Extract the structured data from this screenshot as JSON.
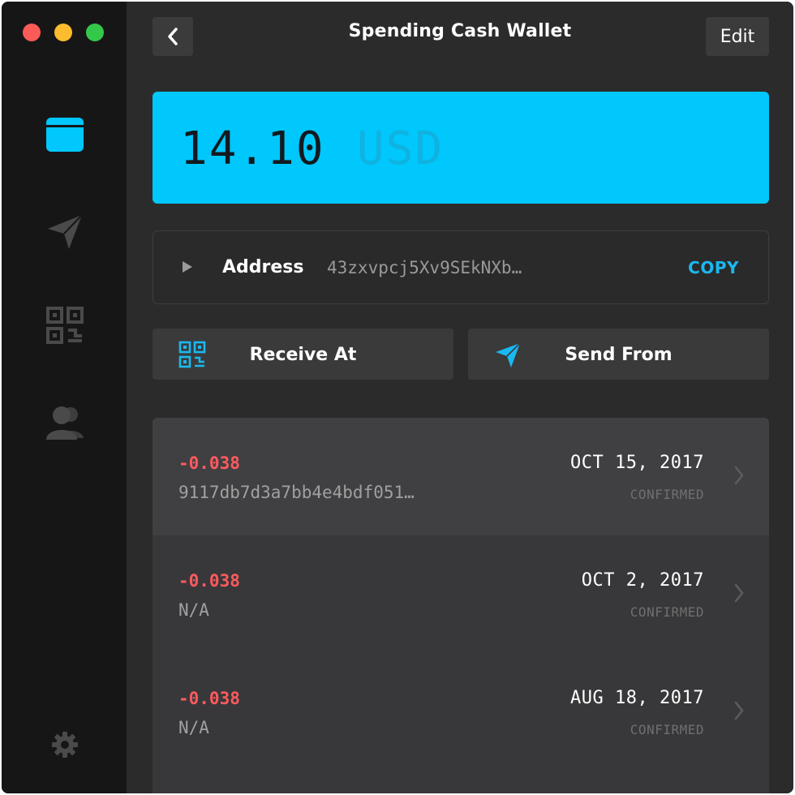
{
  "header": {
    "title": "Spending Cash Wallet",
    "edit_label": "Edit"
  },
  "balance": {
    "amount": "14.10",
    "unit": "USD"
  },
  "address": {
    "label": "Address",
    "value": "43zxvpcj5Xv9SEkNXb…",
    "copy_label": "COPY"
  },
  "actions": {
    "receive_label": "Receive At",
    "send_label": "Send From"
  },
  "transactions": [
    {
      "amount": "-0.038",
      "hash": "9117db7d3a7bb4e4bdf051…",
      "date": "OCT 15, 2017",
      "status": "CONFIRMED"
    },
    {
      "amount": "-0.038",
      "hash": "N/A",
      "date": "OCT 2, 2017",
      "status": "CONFIRMED"
    },
    {
      "amount": "-0.038",
      "hash": "N/A",
      "date": "AUG 18, 2017",
      "status": "CONFIRMED"
    }
  ],
  "colors": {
    "accent": "#00c7fc",
    "negative": "#ff5a5e",
    "sidebar": "#171617",
    "background": "#2b2b2c"
  },
  "icons": {
    "nav": [
      "wallet-icon",
      "send-icon",
      "qr-code-icon",
      "contacts-icon",
      "gear-icon"
    ]
  }
}
